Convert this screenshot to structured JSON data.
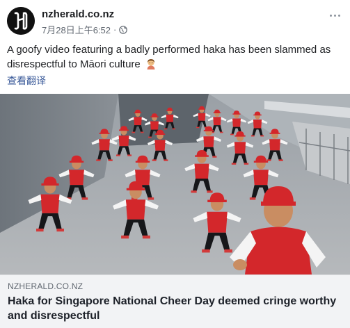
{
  "post": {
    "page_name": "nzherald.co.nz",
    "timestamp": "7月28日上午6:52",
    "separator": "·",
    "caption": "A goofy video featuring a badly performed haka has been slammed as disrespectful to Māori culture",
    "translate_label": "查看翻译",
    "icons": {
      "avatar": "nz-herald-logo",
      "privacy": "globe-icon",
      "menu": "more-options-icon",
      "emoji": "person-gesturing-emoji"
    }
  },
  "link_preview": {
    "domain": "NZHERALD.CO.NZ",
    "title": "Haka for Singapore National Cheer Day deemed cringe worthy and disrespectful"
  },
  "colors": {
    "link_blue": "#385898",
    "uniform_red": "#d3272b",
    "preview_bg": "#f2f3f5"
  }
}
